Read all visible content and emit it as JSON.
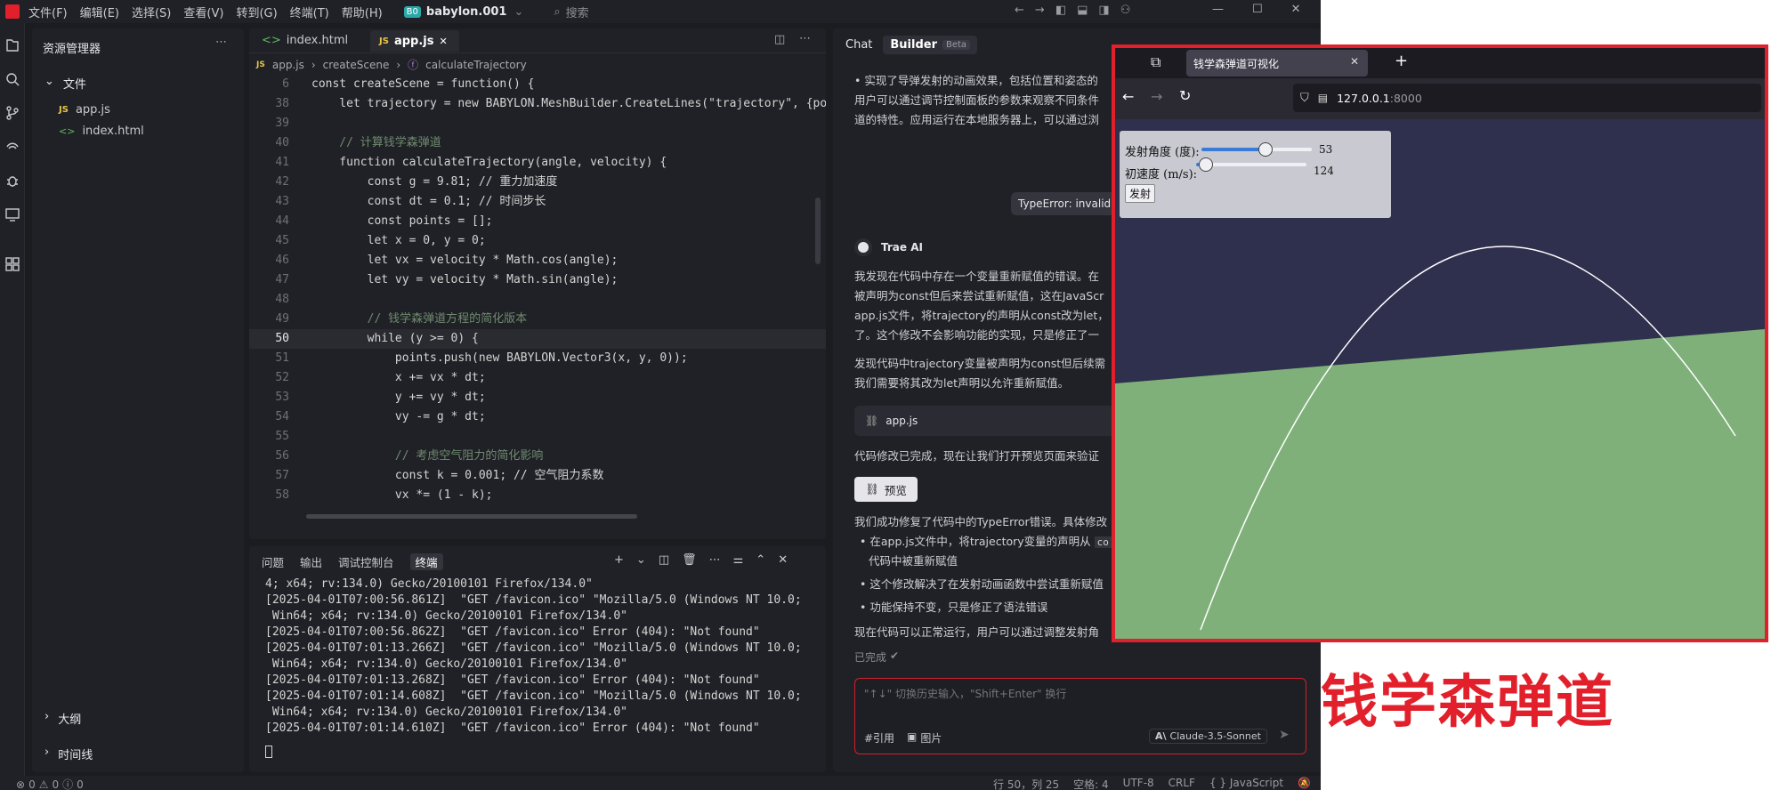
{
  "menu": [
    "文件(F)",
    "编辑(E)",
    "选择(S)",
    "查看(V)",
    "转到(G)",
    "终端(T)",
    "帮助(H)"
  ],
  "workspace": {
    "badge": "B0",
    "name": "babylon.001"
  },
  "search_placeholder": "搜索",
  "explorer": {
    "title": "资源管理器",
    "section": "文件",
    "files": [
      "app.js",
      "index.html"
    ],
    "outline": "大纲",
    "timeline": "时间线"
  },
  "tabs": [
    {
      "label": "index.html"
    },
    {
      "label": "app.js"
    }
  ],
  "breadcrumb": [
    "app.js",
    "createScene",
    "calculateTrajectory"
  ],
  "code": [
    {
      "n": "6",
      "t": "const createScene = function() {"
    },
    {
      "n": "38",
      "t": "    let trajectory = new BABYLON.MeshBuilder.CreateLines(\"trajectory\", {po"
    },
    {
      "n": "39",
      "t": ""
    },
    {
      "n": "40",
      "t": "    // 计算钱学森弹道"
    },
    {
      "n": "41",
      "t": "    function calculateTrajectory(angle, velocity) {"
    },
    {
      "n": "42",
      "t": "        const g = 9.81; // 重力加速度"
    },
    {
      "n": "43",
      "t": "        const dt = 0.1; // 时间步长"
    },
    {
      "n": "44",
      "t": "        const points = [];"
    },
    {
      "n": "45",
      "t": "        let x = 0, y = 0;"
    },
    {
      "n": "46",
      "t": "        let vx = velocity * Math.cos(angle);"
    },
    {
      "n": "47",
      "t": "        let vy = velocity * Math.sin(angle);"
    },
    {
      "n": "48",
      "t": ""
    },
    {
      "n": "49",
      "t": "        // 钱学森弹道方程的简化版本"
    },
    {
      "n": "50",
      "t": "        while (y >= 0) {"
    },
    {
      "n": "51",
      "t": "            points.push(new BABYLON.Vector3(x, y, 0));"
    },
    {
      "n": "52",
      "t": "            x += vx * dt;"
    },
    {
      "n": "53",
      "t": "            y += vy * dt;"
    },
    {
      "n": "54",
      "t": "            vy -= g * dt;"
    },
    {
      "n": "55",
      "t": ""
    },
    {
      "n": "56",
      "t": "            // 考虑空气阻力的简化影响"
    },
    {
      "n": "57",
      "t": "            const k = 0.001; // 空气阻力系数"
    },
    {
      "n": "58",
      "t": "            vx *= (1 - k);"
    }
  ],
  "panel_tabs": [
    "问题",
    "输出",
    "调试控制台",
    "终端"
  ],
  "terminal": [
    "4; x64; rv:134.0) Gecko/20100101 Firefox/134.0\"",
    "[2025-04-01T07:00:56.861Z]  \"GET /favicon.ico\" \"Mozilla/5.0 (Windows NT 10.0;",
    " Win64; x64; rv:134.0) Gecko/20100101 Firefox/134.0\"",
    "[2025-04-01T07:00:56.862Z]  \"GET /favicon.ico\" Error (404): \"Not found\"",
    "[2025-04-01T07:01:13.266Z]  \"GET /favicon.ico\" \"Mozilla/5.0 (Windows NT 10.0;",
    " Win64; x64; rv:134.0) Gecko/20100101 Firefox/134.0\"",
    "[2025-04-01T07:01:13.268Z]  \"GET /favicon.ico\" Error (404): \"Not found\"",
    "[2025-04-01T07:01:14.608Z]  \"GET /favicon.ico\" \"Mozilla/5.0 (Windows NT 10.0;",
    " Win64; x64; rv:134.0) Gecko/20100101 Firefox/134.0\"",
    "[2025-04-01T07:01:14.610Z]  \"GET /favicon.ico\" Error (404): \"Not found\""
  ],
  "chat": {
    "tab_chat": "Chat",
    "tab_builder": "Builder",
    "beta": "Beta",
    "top_lines": [
      "•  实现了导弹发射的动画效果，包括位置和姿态的",
      "用户可以通过调节控制面板的参数来观察不同条件",
      "道的特性。应用运行在本地服务器上，可以通过浏"
    ],
    "error_chip": "TypeError: invalid",
    "ai_name": "Trae AI",
    "para1": [
      "我发现在代码中存在一个变量重新赋值的错误。在",
      "被声明为const但后来尝试重新赋值，这在JavaScr",
      "app.js文件，将trajectory的声明从const改为let，",
      "了。这个修改不会影响功能的实现，只是修正了一"
    ],
    "para2": [
      "发现代码中trajectory变量被声明为const但后续需",
      "我们需要将其改为let声明以允许重新赋值。"
    ],
    "file_chip": "app.js",
    "line_preview_intro": "代码修改已完成，现在让我们打开预览页面来验证",
    "preview_button": "预览",
    "fix_intro": "我们成功修复了代码中的TypeError错误。具体修改",
    "bullets": [
      "在app.js文件中，将trajectory变量的声明从",
      "代码中被重新赋值",
      "这个修改解决了在发射动画函数中尝试重新赋值",
      "功能保持不变，只是修正了语法错误"
    ],
    "code_chip": "co",
    "closing": "现在代码可以正常运行，用户可以通过调整发射角",
    "done": "已完成",
    "input_placeholder": "\"↑↓\" 切换历史输入，\"Shift+Enter\" 换行",
    "ref": "#引用",
    "image": "图片",
    "model": "Claude-3.5-Sonnet"
  },
  "status": {
    "errors": "0",
    "warnings": "0",
    "info": "0",
    "position": "行 50，列 25",
    "spaces": "空格: 4",
    "encoding": "UTF-8",
    "eol": "CRLF",
    "language": "{ } JavaScript"
  },
  "browser": {
    "tab_title": "钱学森弹道可视化",
    "url_host": "127.0.0.1",
    "url_port": ":8000",
    "angle_label": "发射角度 (度):",
    "angle_value": "53",
    "angle_fraction": 0.59,
    "velocity_label": "初速度 (m/s):",
    "velocity_value": "124",
    "velocity_fraction": 0.03,
    "fire_button": "发射"
  },
  "caption": "钱学森弹道",
  "colors": {
    "accent": "#3a7bd5",
    "error": "#e2202b",
    "ground": "#7fb07a",
    "sky": "#2f2f4e"
  }
}
